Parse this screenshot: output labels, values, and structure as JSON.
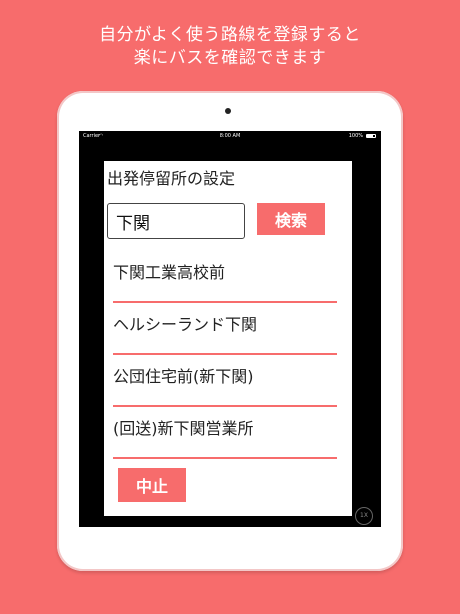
{
  "promo": {
    "line1": "自分がよく使う路線を登録すると",
    "line2": "楽にバスを確認できます"
  },
  "status_bar": {
    "carrier": "Carrier",
    "time": "8:00 AM",
    "battery": "100%"
  },
  "dialog": {
    "title": "出発停留所の設定",
    "search_value": "下関",
    "search_button": "検索",
    "results": [
      "下関工業高校前",
      "ヘルシーランド下関",
      "公団住宅前(新下関)",
      "(回送)新下関営業所"
    ],
    "cancel_button": "中止"
  },
  "zoom_badge": "1X",
  "colors": {
    "accent": "#F76C6C",
    "background": "#F76C6C",
    "screen_bg": "#000000"
  }
}
